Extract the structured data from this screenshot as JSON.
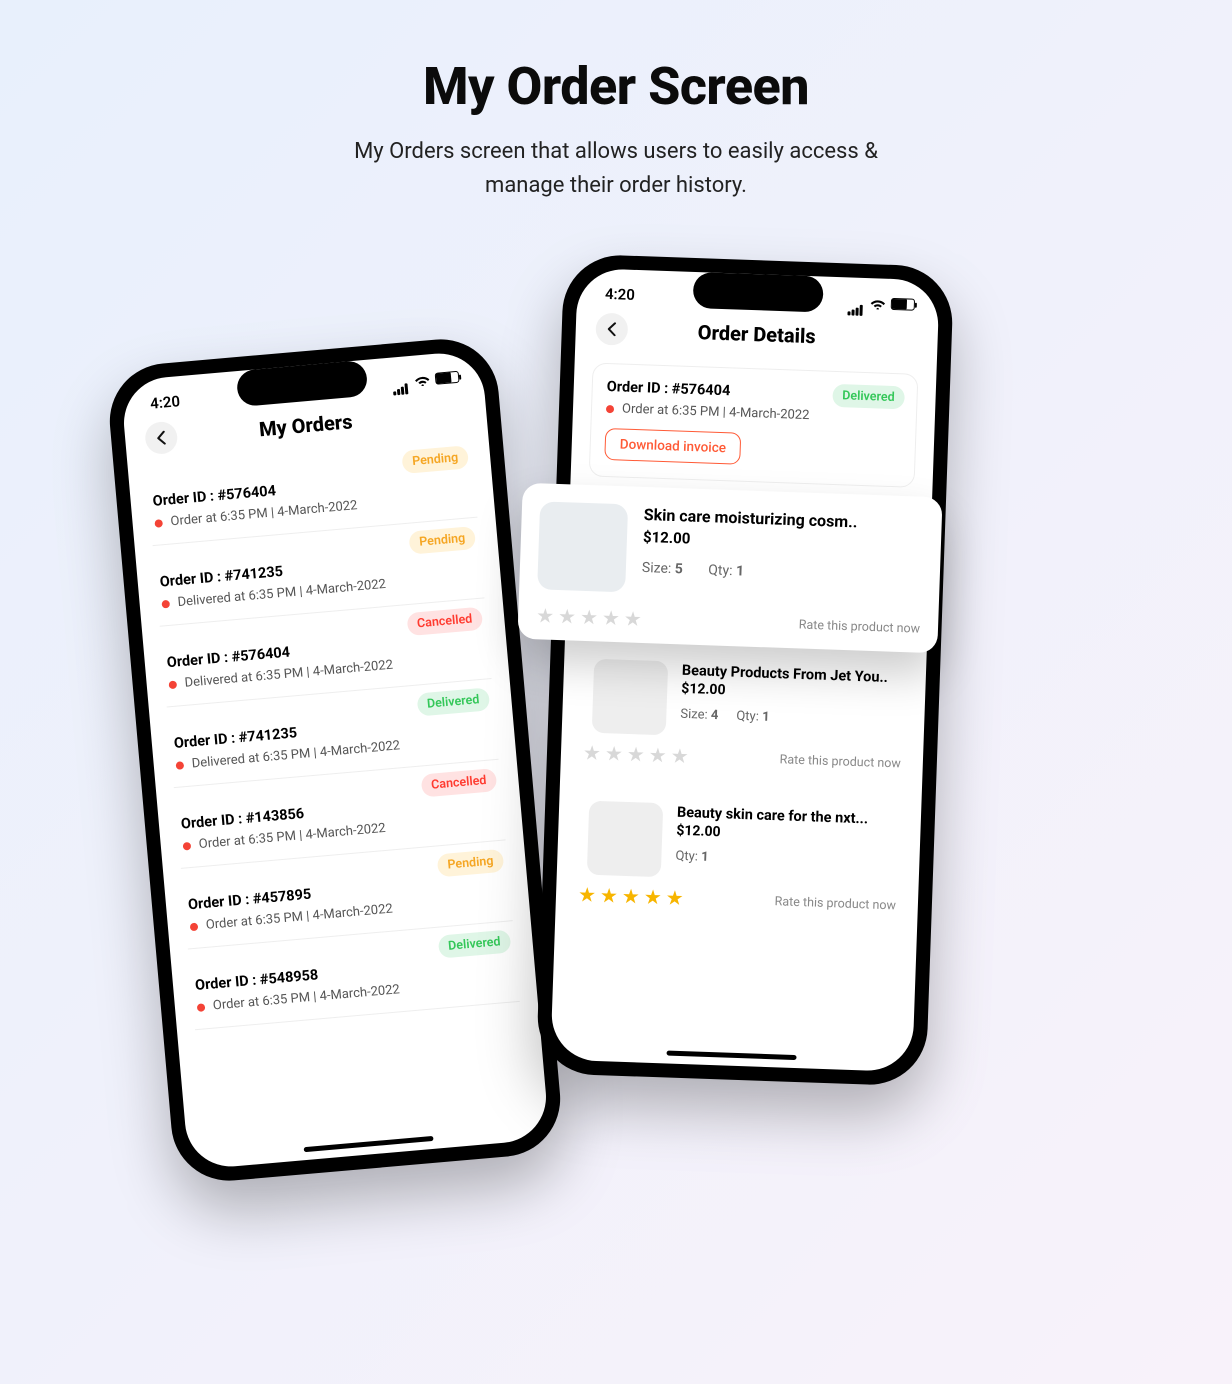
{
  "hero": {
    "title": "My Order Screen",
    "subtitle_line1": "My Orders screen that allows users to easily access &",
    "subtitle_line2": "manage their order history."
  },
  "status_time": "4:20",
  "order_id_prefix": "Order ID : ",
  "my_orders": {
    "title": "My Orders",
    "orders": [
      {
        "id": "#576404",
        "line": "Order at 6:35 PM | 4-March-2022",
        "status": "Pending",
        "cls": "pending"
      },
      {
        "id": "#741235",
        "line": "Delivered at 6:35 PM | 4-March-2022",
        "status": "Pending",
        "cls": "pending"
      },
      {
        "id": "#576404",
        "line": "Delivered at 6:35 PM | 4-March-2022",
        "status": "Cancelled",
        "cls": "cancelled"
      },
      {
        "id": "#741235",
        "line": "Delivered at 6:35 PM | 4-March-2022",
        "status": "Delivered",
        "cls": "delivered"
      },
      {
        "id": "#143856",
        "line": "Order at 6:35 PM | 4-March-2022",
        "status": "Cancelled",
        "cls": "cancelled"
      },
      {
        "id": "#457895",
        "line": "Order at 6:35 PM | 4-March-2022",
        "status": "Pending",
        "cls": "pending"
      },
      {
        "id": "#548958",
        "line": "Order at 6:35 PM | 4-March-2022",
        "status": "Delivered",
        "cls": "delivered"
      }
    ]
  },
  "order_details": {
    "title": "Order Details",
    "id": "#576404",
    "line": "Order at 6:35 PM | 4-March-2022",
    "status": "Delivered",
    "download_label": "Download invoice",
    "items": [
      {
        "name": "Skin care moisturizing cosm..",
        "price": "$12.00",
        "size": "5",
        "qty": "1",
        "thumb": "th-a",
        "stars": 0
      },
      {
        "name": "Beauty Products From Jet You..",
        "price": "$12.00",
        "size": "4",
        "qty": "1",
        "thumb": "th-b",
        "stars": 0
      },
      {
        "name": "Beauty skin care for the nxt...",
        "price": "$12.00",
        "size": "",
        "qty": "1",
        "thumb": "th-c",
        "stars": 5
      }
    ],
    "size_label": "Size:",
    "qty_label": "Qty:",
    "rate_label": "Rate this product now"
  }
}
